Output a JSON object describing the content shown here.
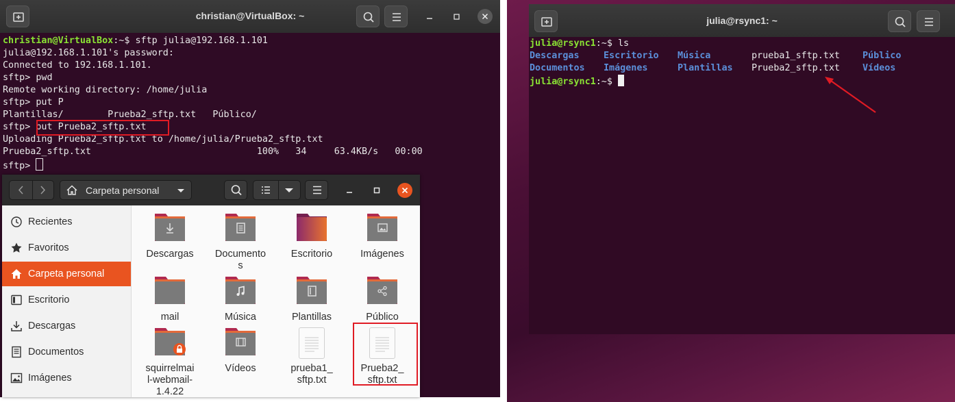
{
  "left_terminal": {
    "title": "christian@VirtualBox: ~",
    "prompt_user": "christian@VirtualBox",
    "prompt_suffix": ":~$ ",
    "lines": {
      "l1_cmd": "sftp julia@192.168.1.101",
      "l2": "julia@192.168.1.101's password:",
      "l3": "Connected to 192.168.1.101.",
      "l4": "sftp> pwd",
      "l5": "Remote working directory: /home/julia",
      "l6": "sftp> put P",
      "l7": "Plantillas/        Prueba2_sftp.txt   Público/",
      "l8_prefix": "sftp> ",
      "l8_cmd": "put Prueba2_sftp.txt",
      "l9": "Uploading Prueba2_sftp.txt to /home/julia/Prueba2_sftp.txt",
      "l10": "Prueba2_sftp.txt                              100%   34     63.4KB/s   00:00",
      "l11": "sftp> "
    },
    "icons": {
      "new_tab": "new-tab-icon",
      "search": "search-icon",
      "menu": "hamburger-menu-icon"
    }
  },
  "file_manager": {
    "location": "Carpeta personal",
    "sidebar": [
      {
        "label": "Recientes",
        "icon": "clock-icon"
      },
      {
        "label": "Favoritos",
        "icon": "star-icon"
      },
      {
        "label": "Carpeta personal",
        "icon": "home-icon",
        "active": true
      },
      {
        "label": "Escritorio",
        "icon": "desktop-icon"
      },
      {
        "label": "Descargas",
        "icon": "download-icon"
      },
      {
        "label": "Documentos",
        "icon": "document-icon"
      },
      {
        "label": "Imágenes",
        "icon": "image-icon"
      }
    ],
    "items": [
      {
        "name": "Descargas",
        "type": "folder"
      },
      {
        "name": "Documentos",
        "type": "folder"
      },
      {
        "name": "Escritorio",
        "type": "folder"
      },
      {
        "name": "Imágenes",
        "type": "folder"
      },
      {
        "name": "mail",
        "type": "folder"
      },
      {
        "name": "Música",
        "type": "folder"
      },
      {
        "name": "Plantillas",
        "type": "folder"
      },
      {
        "name": "Público",
        "type": "folder"
      },
      {
        "name": "squirrelmail-webmail-1.4.22",
        "type": "folder"
      },
      {
        "name": "Vídeos",
        "type": "folder"
      },
      {
        "name": "prueba1_sftp.txt",
        "type": "file"
      },
      {
        "name": "Prueba2_sftp.txt",
        "type": "file"
      }
    ],
    "colors": {
      "accent": "#e95420"
    }
  },
  "right_terminal": {
    "title": "julia@rsync1: ~",
    "prompt_user": "julia@rsync1",
    "prompt_suffix": ":~$ ",
    "cmd": "ls",
    "listing": [
      [
        "Descargas",
        "Escritorio",
        "Música",
        "prueba1_sftp.txt",
        "Público"
      ],
      [
        "Documentos",
        "Imágenes",
        "Plantillas",
        "Prueba2_sftp.txt",
        "Vídeos"
      ]
    ]
  }
}
